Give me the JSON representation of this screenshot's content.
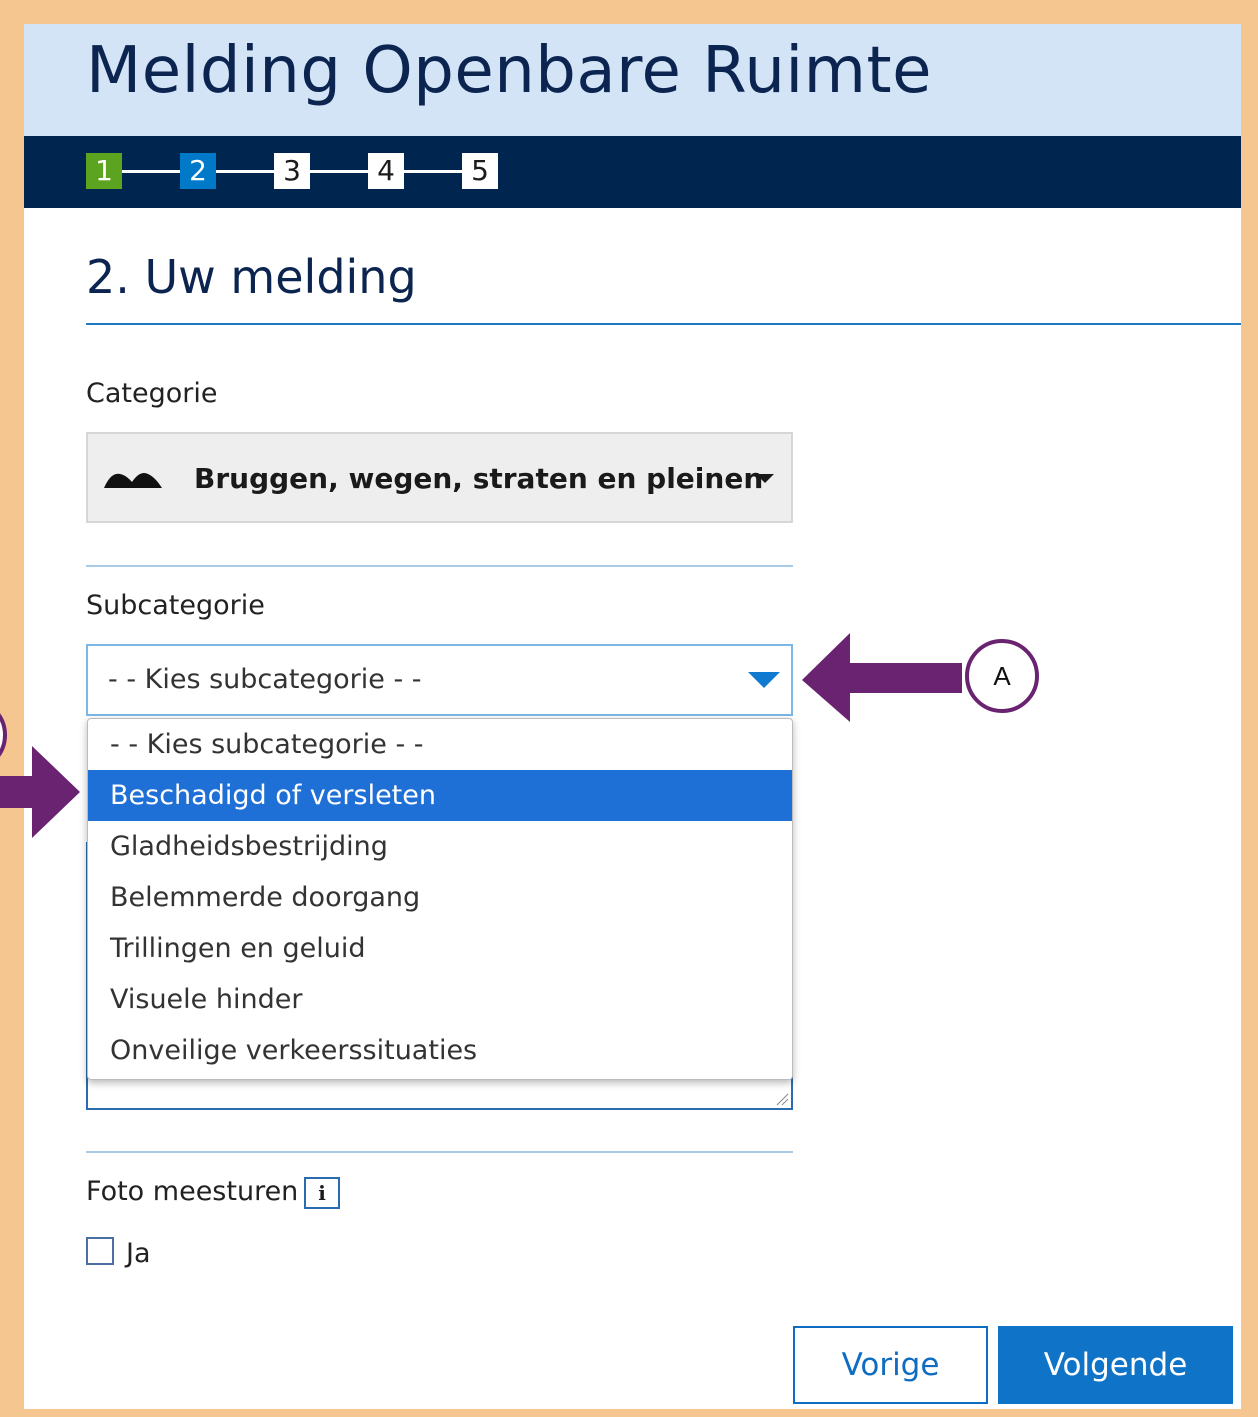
{
  "app": {
    "title": "Melding Openbare Ruimte"
  },
  "steps": [
    "1",
    "2",
    "3",
    "4",
    "5"
  ],
  "section": {
    "title": "2. Uw melding"
  },
  "categorie": {
    "label": "Categorie",
    "value": "Bruggen, wegen, straten en pleinen",
    "icon": "road-bumps-icon"
  },
  "subcategorie": {
    "label": "Subcategorie",
    "value": "- - Kies subcategorie - -",
    "options": [
      "- - Kies subcategorie - -",
      "Beschadigd of versleten",
      "Gladheidsbestrijding",
      "Belemmerde doorgang",
      "Trillingen en geluid",
      "Visuele hinder",
      "Onveilige verkeerssituaties"
    ],
    "highlighted": "Beschadigd of versleten"
  },
  "foto": {
    "label": "Foto meesturen",
    "info": "i",
    "checkbox_label": "Ja"
  },
  "buttons": {
    "prev": "Vorige",
    "next": "Volgende"
  },
  "annotation": {
    "marker": "A",
    "color": "#6a2370"
  },
  "colors": {
    "header": "#d3e4f6",
    "stepbar": "#002650",
    "accent": "#0f73c8",
    "frame": "#f5c690",
    "step_done": "#5ca41f",
    "highlight": "#1e6fd6"
  }
}
